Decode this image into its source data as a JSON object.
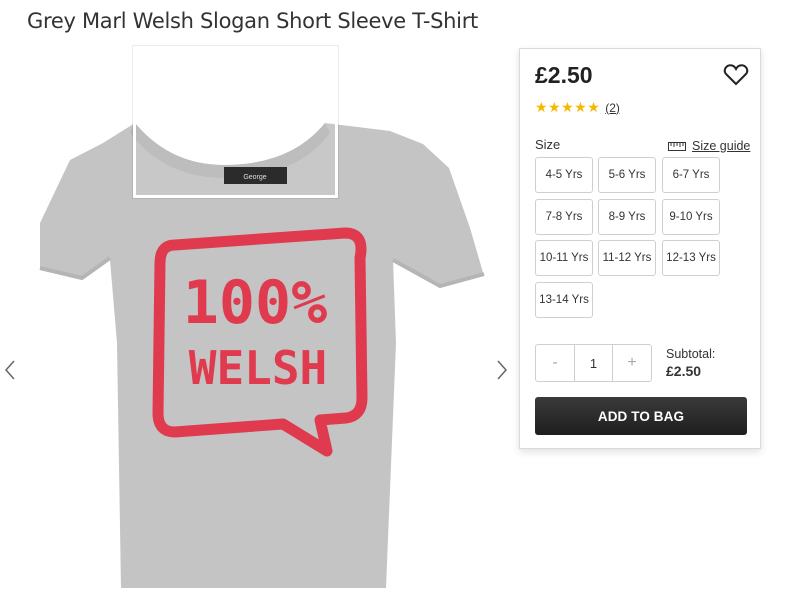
{
  "product": {
    "title": "Grey Marl Welsh Slogan Short Sleeve T-Shirt",
    "image": {
      "shirt_color": "#c4c4c4",
      "print_color": "#e03a4e",
      "print_line1": "100%",
      "print_line2": "WELSH",
      "neck_label": "George"
    }
  },
  "panel": {
    "price": "£2.50",
    "rating": {
      "stars": "★★★★★",
      "review_count": "(2)"
    },
    "size_label": "Size",
    "size_guide_label": "Size guide",
    "sizes": [
      "4-5 Yrs",
      "5-6 Yrs",
      "6-7 Yrs",
      "7-8 Yrs",
      "8-9 Yrs",
      "9-10 Yrs",
      "10-11 Yrs",
      "11-12 Yrs",
      "12-13 Yrs",
      "13-14 Yrs"
    ],
    "quantity": {
      "minus": "-",
      "value": "1",
      "plus": "+"
    },
    "subtotal_label": "Subtotal:",
    "subtotal_value": "£2.50",
    "add_to_bag": "ADD TO BAG"
  },
  "colors": {
    "accent_dark": "#222222",
    "star": "#f5b800"
  }
}
